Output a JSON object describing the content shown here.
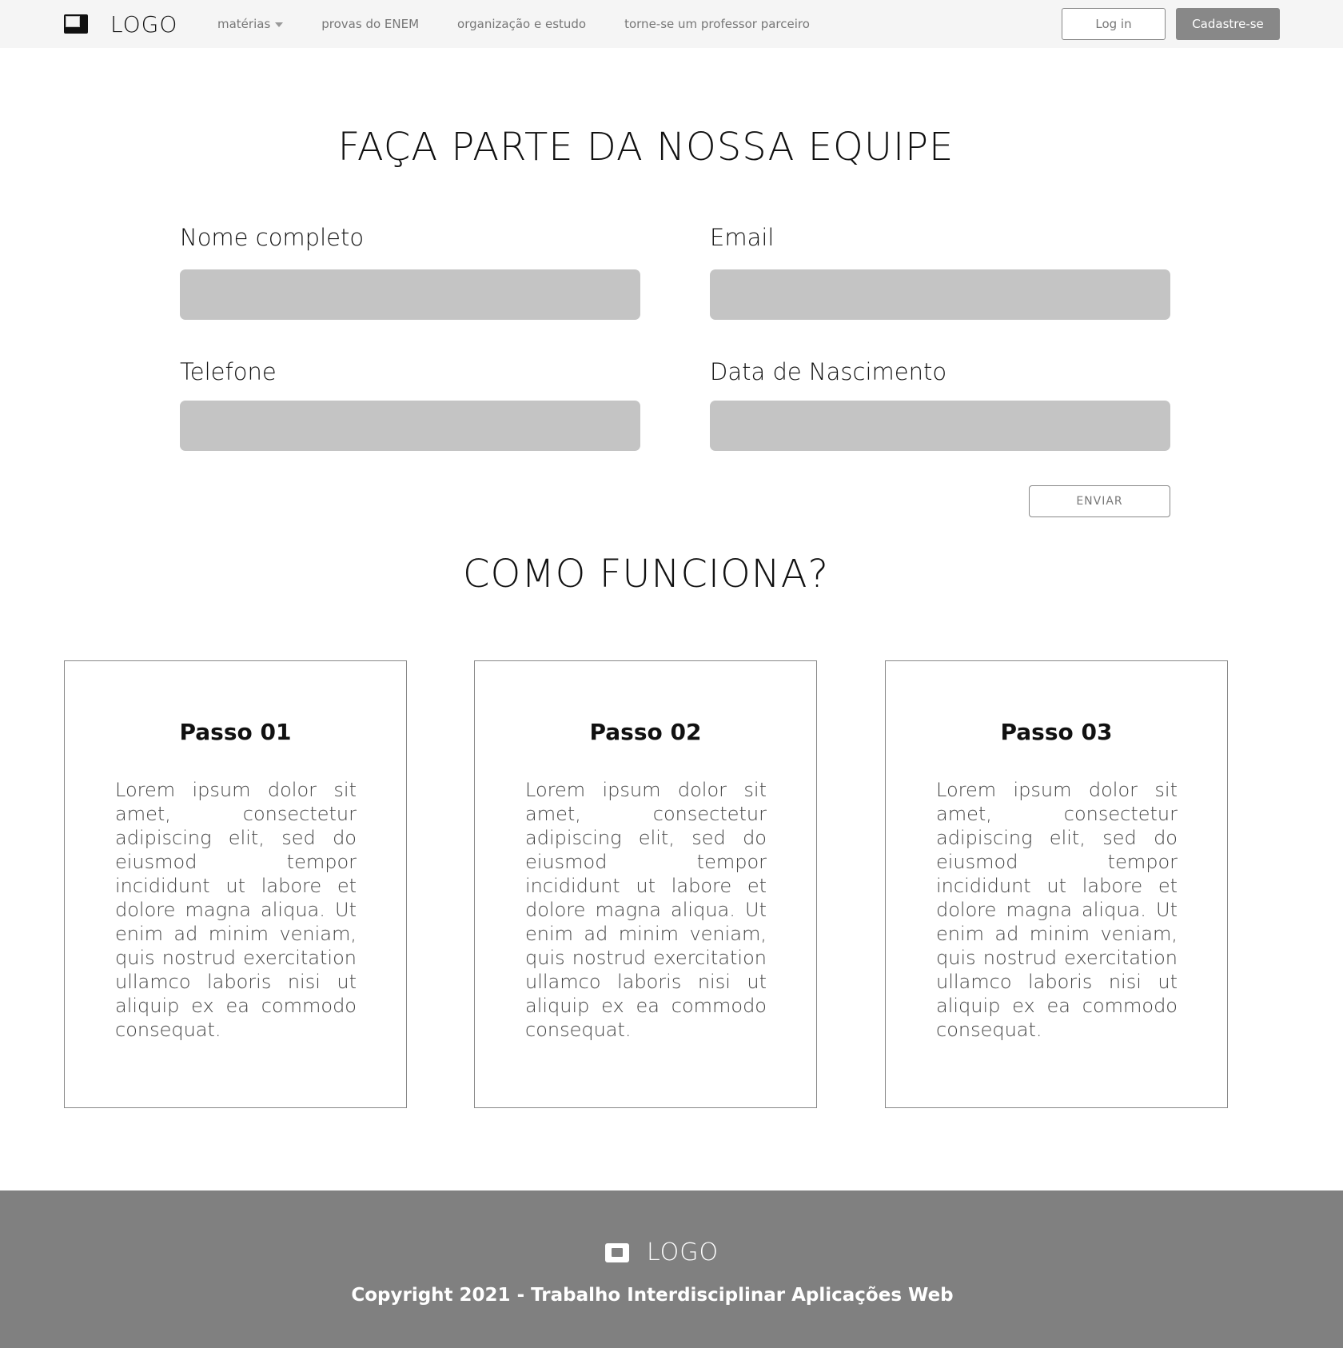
{
  "nav": {
    "logo_text": "LOGO",
    "links": [
      "matérias",
      "provas do ENEM",
      "organização e estudo",
      "torne-se um professor parceiro"
    ],
    "login_label": "Log in",
    "signup_label": "Cadastre-se"
  },
  "team": {
    "title": "FAÇA PARTE DA NOSSA EQUIPE",
    "fields": [
      {
        "label": "Nome completo",
        "value": ""
      },
      {
        "label": "Email",
        "value": ""
      },
      {
        "label": "Telefone",
        "value": ""
      },
      {
        "label": "Data de Nascimento",
        "value": ""
      }
    ],
    "submit_label": "ENVIAR"
  },
  "how": {
    "title": "COMO FUNCIONA?",
    "steps": [
      {
        "title": "Passo 01",
        "text": "Lorem ipsum dolor sit amet, consectetur adipiscing elit, sed do eiusmod tempor incididunt ut labore et dolore magna aliqua. Ut enim ad minim veniam, quis nostrud exercitation ullamco laboris nisi ut aliquip ex ea commodo consequat."
      },
      {
        "title": "Passo 02",
        "text": "Lorem ipsum dolor sit amet, consectetur adipiscing elit, sed do eiusmod tempor incididunt ut labore et dolore magna aliqua. Ut enim ad minim veniam, quis nostrud exercitation ullamco laboris nisi ut aliquip ex ea commodo consequat."
      },
      {
        "title": "Passo 03",
        "text": "Lorem ipsum dolor sit amet, consectetur adipiscing elit, sed do eiusmod tempor incididunt ut labore et dolore magna aliqua. Ut enim ad minim veniam, quis nostrud exercitation ullamco laboris nisi ut aliquip ex ea commodo consequat."
      }
    ]
  },
  "footer": {
    "logo_text": "LOGO",
    "copyright": "Copyright 2021 - Trabalho Interdisciplinar Aplicações Web"
  },
  "colors": {
    "navbar_bg": "#f5f5f5",
    "input_bg": "#c4c4c4",
    "signup_bg": "#888888",
    "footer_bg": "#808080"
  },
  "icons": {
    "nav_logo": "logo-icon",
    "dropdown": "caret-down-icon",
    "footer_logo": "logo-icon"
  }
}
